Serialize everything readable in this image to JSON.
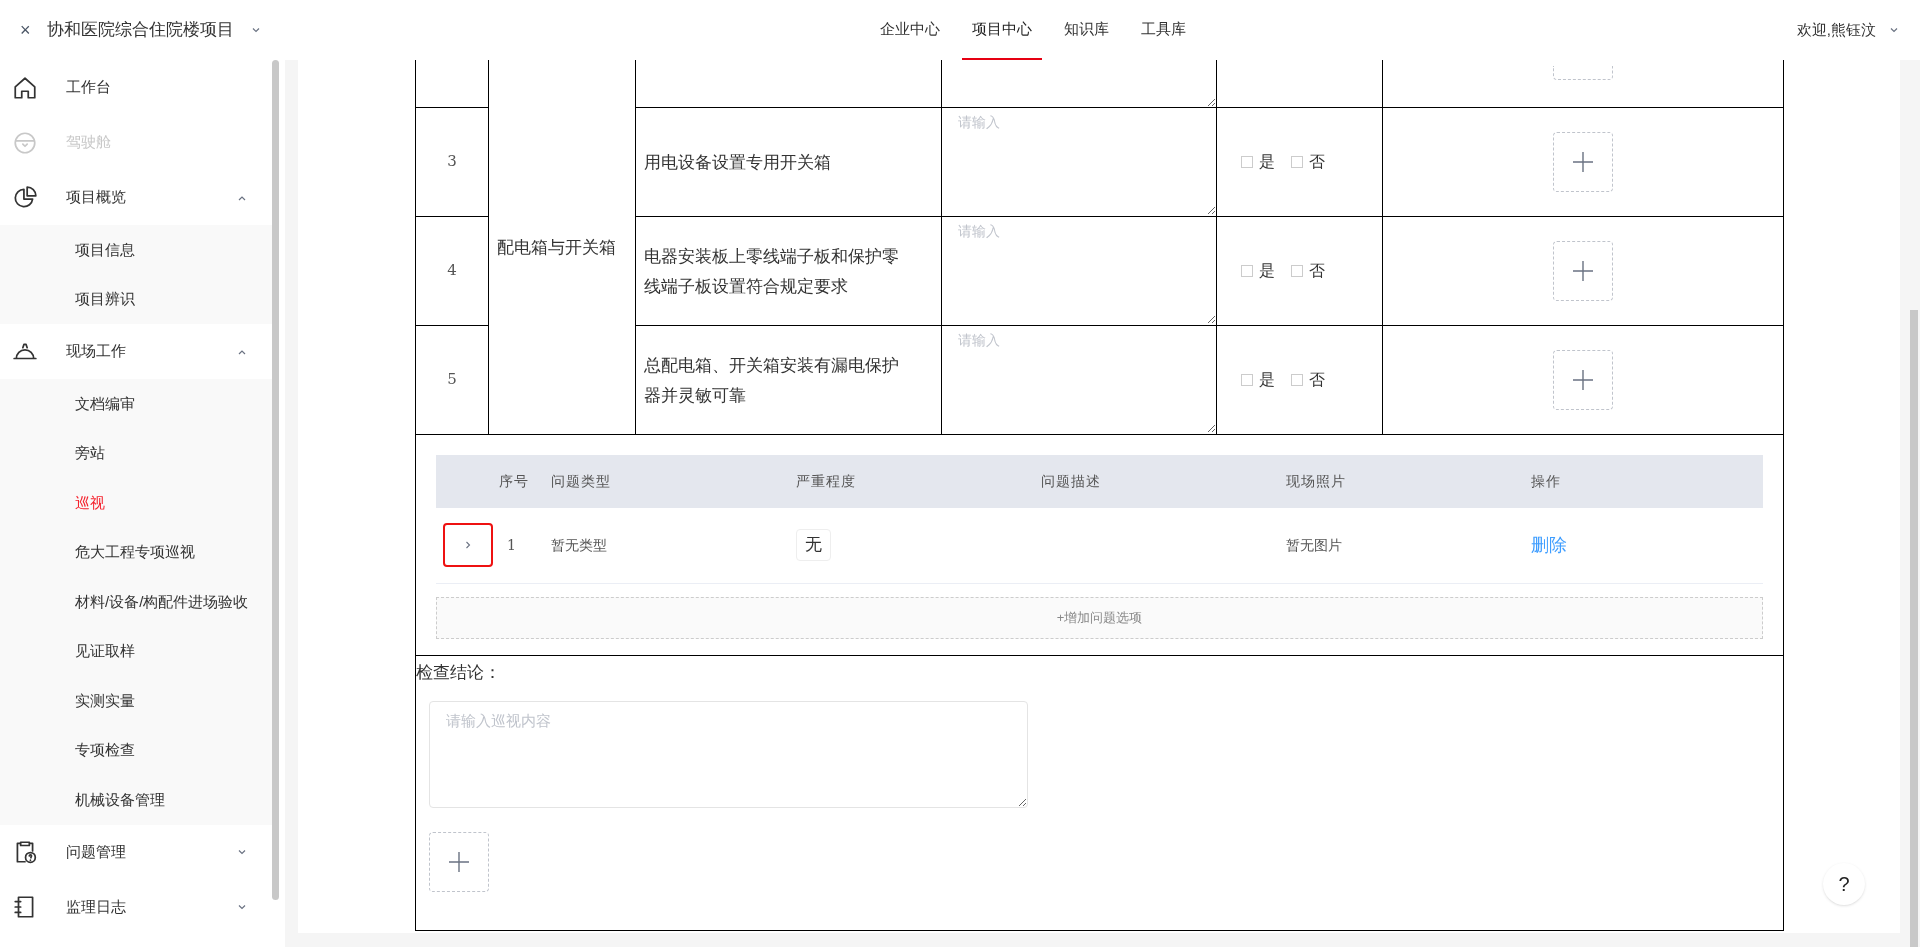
{
  "header": {
    "close": "×",
    "project": "协和医院综合住院楼项目",
    "nav": [
      {
        "label": "企业中心",
        "selected": false
      },
      {
        "label": "项目中心",
        "selected": true
      },
      {
        "label": "知识库",
        "selected": false
      },
      {
        "label": "工具库",
        "selected": false
      }
    ],
    "user": "欢迎,熊钰汶"
  },
  "sidebar": {
    "items": [
      {
        "label": "工作台",
        "disabled": false
      },
      {
        "label": "驾驶舱",
        "disabled": true
      },
      {
        "label": "项目概览",
        "disabled": false,
        "expanded": true,
        "children": [
          {
            "label": "项目信息",
            "selected": false
          },
          {
            "label": "项目辨识",
            "selected": false
          }
        ]
      },
      {
        "label": "现场工作",
        "disabled": false,
        "expanded": true,
        "children": [
          {
            "label": "文档编审",
            "selected": false
          },
          {
            "label": "旁站",
            "selected": false
          },
          {
            "label": "巡视",
            "selected": true
          },
          {
            "label": "危大工程专项巡视",
            "selected": false
          },
          {
            "label": "材料/设备/构配件进场验收",
            "selected": false
          },
          {
            "label": "见证取样",
            "selected": false
          },
          {
            "label": "实测实量",
            "selected": false
          },
          {
            "label": "专项检查",
            "selected": false
          },
          {
            "label": "机械设备管理",
            "selected": false
          }
        ]
      },
      {
        "label": "问题管理",
        "disabled": false,
        "expanded": false
      },
      {
        "label": "监理日志",
        "disabled": false,
        "expanded": false
      }
    ]
  },
  "checklist": {
    "category": "配电箱与开关箱",
    "rows": [
      {
        "no": "3",
        "item": "用电设备设置专用开关箱",
        "placeholder": "请输入",
        "yes": "是",
        "no_label": "否",
        "yes_checked": false,
        "no_checked": false
      },
      {
        "no": "4",
        "item": "电器安装板上零线端子板和保护零线端子板设置符合规定要求",
        "placeholder": "请输入",
        "yes": "是",
        "no_label": "否",
        "yes_checked": false,
        "no_checked": false
      },
      {
        "no": "5",
        "item": "总配电箱、开关箱安装有漏电保护器并灵敏可靠",
        "placeholder": "请输入",
        "yes": "是",
        "no_label": "否",
        "yes_checked": false,
        "no_checked": false
      }
    ]
  },
  "issues": {
    "columns": [
      "序号",
      "问题类型",
      "严重程度",
      "问题描述",
      "现场照片",
      "操作"
    ],
    "rows": [
      {
        "expanded": false,
        "highlighted": true,
        "no": "1",
        "type": "暂无类型",
        "severity": "无",
        "photo": "暂无图片",
        "action": "删除"
      }
    ],
    "add_button": "+增加问题选项"
  },
  "conclusion": {
    "label": "检查结论：",
    "placeholder": "请输入巡视内容"
  },
  "help": "?"
}
